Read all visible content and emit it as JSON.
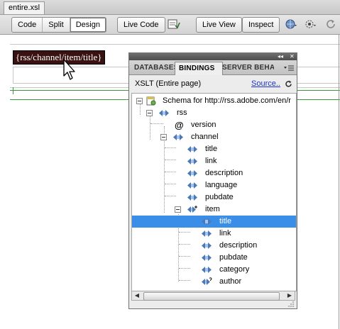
{
  "document": {
    "tab_label": "entire.xsl"
  },
  "toolbar": {
    "view_buttons": [
      "Code",
      "Split",
      "Design"
    ],
    "live_code": "Live Code",
    "live_view": "Live View",
    "inspect": "Inspect"
  },
  "design_view": {
    "binding_text": "{rss/channel/item/title}"
  },
  "panel": {
    "tabs": [
      "DATABASES",
      "BINDINGS",
      "SERVER BEHA"
    ],
    "active_tab": "BINDINGS",
    "xslt_label": "XSLT (Entire page)",
    "source_link": "Source..",
    "tree": [
      {
        "label": "Schema for http://rss.adobe.com/en/r",
        "icon": "schema-icon"
      },
      {
        "label": "rss",
        "icon": "element-icon"
      },
      {
        "label": "version",
        "icon": "attribute-icon"
      },
      {
        "label": "channel",
        "icon": "element-icon"
      },
      {
        "label": "title",
        "icon": "element-icon"
      },
      {
        "label": "link",
        "icon": "element-icon"
      },
      {
        "label": "description",
        "icon": "element-icon"
      },
      {
        "label": "language",
        "icon": "element-icon"
      },
      {
        "label": "pubdate",
        "icon": "element-icon"
      },
      {
        "label": "item",
        "icon": "repeating-element-icon"
      },
      {
        "label": "title",
        "icon": "element-icon"
      },
      {
        "label": "link",
        "icon": "element-icon"
      },
      {
        "label": "description",
        "icon": "element-icon"
      },
      {
        "label": "pubdate",
        "icon": "element-icon"
      },
      {
        "label": "category",
        "icon": "element-icon"
      },
      {
        "label": "author",
        "icon": "optional-element-icon"
      }
    ]
  },
  "colors": {
    "selection": "#3b8ee8",
    "binding_bg": "#3a1212",
    "link": "#1a33cc"
  }
}
